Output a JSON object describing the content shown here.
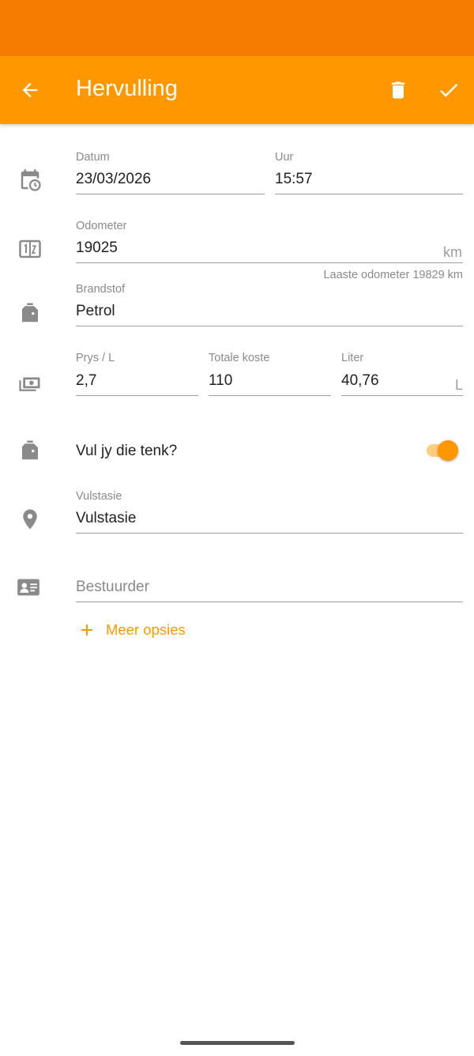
{
  "appbar": {
    "title": "Hervulling",
    "back_icon": "arrow-left-icon",
    "delete_icon": "trash-icon",
    "save_icon": "check-icon"
  },
  "datetime": {
    "date_label": "Datum",
    "date_value": "23/03/2026",
    "time_label": "Uur",
    "time_value": "15:57"
  },
  "odometer": {
    "label": "Odometer",
    "value": "19025",
    "unit": "km",
    "helper": "Laaste odometer 19829 km"
  },
  "fuel": {
    "label": "Brandstof",
    "value": "Petrol"
  },
  "costs": {
    "price_label": "Prys / L",
    "price_value": "2,7",
    "total_label": "Totale koste",
    "total_value": "110",
    "liter_label": "Liter",
    "liter_value": "40,76",
    "liter_unit": "L"
  },
  "full_tank": {
    "label": "Vul jy die tenk?",
    "enabled": true
  },
  "station": {
    "label": "Vulstasie",
    "value": "Vulstasie"
  },
  "driver": {
    "placeholder": "Bestuurder"
  },
  "more_options": {
    "label": "Meer opsies"
  },
  "colors": {
    "status_bar": "#f57c00",
    "app_bar": "#ff9800",
    "accent": "#ff9800",
    "icon_gray": "#8a8a8a"
  }
}
